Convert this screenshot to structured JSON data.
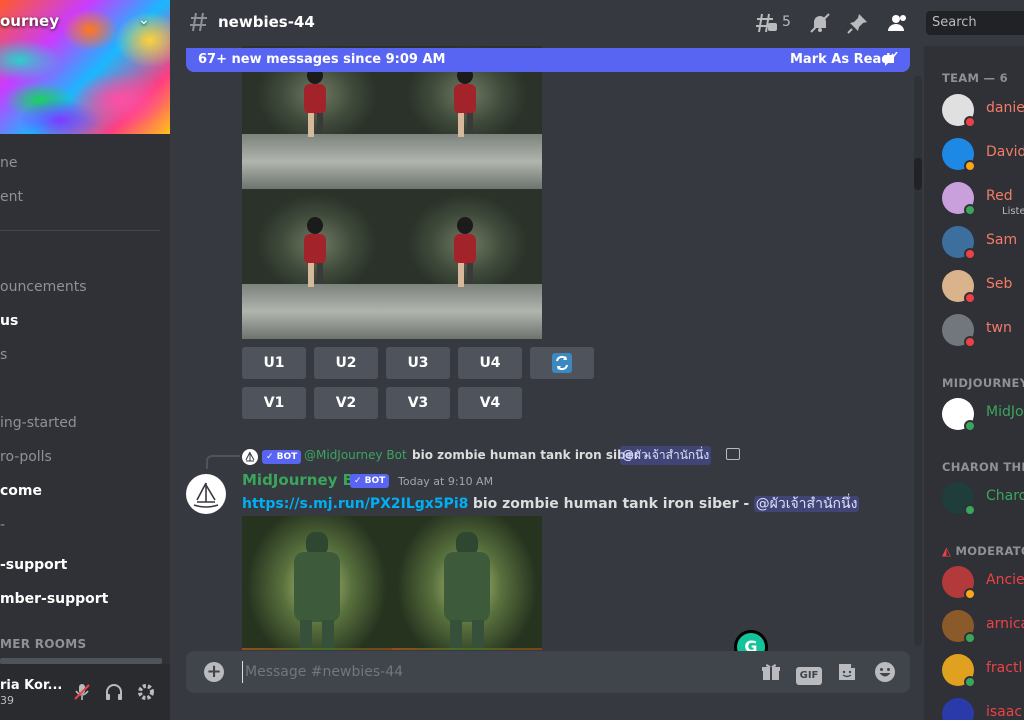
{
  "server": {
    "name": "ourney",
    "chevron": "⌄"
  },
  "sidebar": {
    "channels": [
      {
        "label": "ne",
        "bright": false
      },
      {
        "label": "ent",
        "bright": false
      },
      {
        "label": "ouncements",
        "bright": false
      },
      {
        "label": "us",
        "bright": true
      },
      {
        "label": "s",
        "bright": false
      },
      {
        "label": "ing-started",
        "bright": false
      },
      {
        "label": "ro-polls",
        "bright": false
      },
      {
        "label": "come",
        "bright": true
      },
      {
        "label": "-",
        "bright": false
      },
      {
        "label": "-support",
        "bright": true
      },
      {
        "label": "mber-support",
        "bright": true
      }
    ],
    "category": "MER ROOMS"
  },
  "user": {
    "name": "ria Kor...",
    "tag": "39"
  },
  "header": {
    "channel": "newbies-44",
    "threads_count": "5",
    "search_placeholder": "Search"
  },
  "banner": {
    "text": "67+ new messages since 9:09 AM",
    "mark_read": "Mark As Read"
  },
  "buttons": {
    "upscale": [
      "U1",
      "U2",
      "U3",
      "U4"
    ],
    "variation": [
      "V1",
      "V2",
      "V3",
      "V4"
    ]
  },
  "reply": {
    "bot_tag": "✓ BOT",
    "author": "@MidJourney Bot",
    "prompt": "bio zombie human tank iron siber -",
    "mention": "@ผัวเจ้าสำนักนึ่ง"
  },
  "message": {
    "author": "MidJourney Bot",
    "bot_tag": "✓ BOT",
    "time": "Today at 9:10 AM",
    "link": "https://s.mj.run/PX2ILgx5Pi8",
    "text": "bio zombie human tank iron siber -",
    "mention": "@ผัวเจ้าสำนักนึ่ง"
  },
  "composer": {
    "placeholder": "Message #newbies-44",
    "gif": "GIF"
  },
  "grammarly": "G",
  "members": {
    "groups": [
      "TEAM — 6",
      "MIDJOURNEY",
      "CHARON THE",
      "MODERATO"
    ],
    "list": [
      {
        "name": "danie",
        "color": "#f47b67",
        "avatar": "#e0e0e0",
        "status": "#ed4245",
        "sub": ""
      },
      {
        "name": "David",
        "color": "#f47b67",
        "avatar": "#1e88e5",
        "status": "#faa61a",
        "sub": ""
      },
      {
        "name": "Red",
        "color": "#f47b67",
        "avatar": "#c9a0dc",
        "status": "#3ba55d",
        "sub": "Liste"
      },
      {
        "name": "Sam",
        "color": "#f47b67",
        "avatar": "#3c6e9e",
        "status": "#ed4245",
        "sub": ""
      },
      {
        "name": "Seb",
        "color": "#f47b67",
        "avatar": "#d9b38c",
        "status": "#ed4245",
        "sub": ""
      },
      {
        "name": "twn",
        "color": "#f47b67",
        "avatar": "#72767d",
        "status": "#ed4245",
        "sub": ""
      },
      {
        "name": "MidJo",
        "color": "#3ba55d",
        "avatar": "#ffffff",
        "status": "#3ba55d",
        "sub": ""
      },
      {
        "name": "Charo",
        "color": "#3ba55d",
        "avatar": "#1f3d3a",
        "status": "#3ba55d",
        "sub": ""
      },
      {
        "name": "Ancie",
        "color": "#ed4245",
        "avatar": "#b33a3a",
        "status": "#faa61a",
        "sub": ""
      },
      {
        "name": "arnica",
        "color": "#ed4245",
        "avatar": "#8b5a2b",
        "status": "#3ba55d",
        "sub": ""
      },
      {
        "name": "fractl",
        "color": "#ed4245",
        "avatar": "#e0a020",
        "status": "#3ba55d",
        "sub": ""
      },
      {
        "name": "isaac",
        "color": "#ed4245",
        "avatar": "#2a3aa8",
        "status": "#3ba55d",
        "sub": ""
      }
    ]
  }
}
